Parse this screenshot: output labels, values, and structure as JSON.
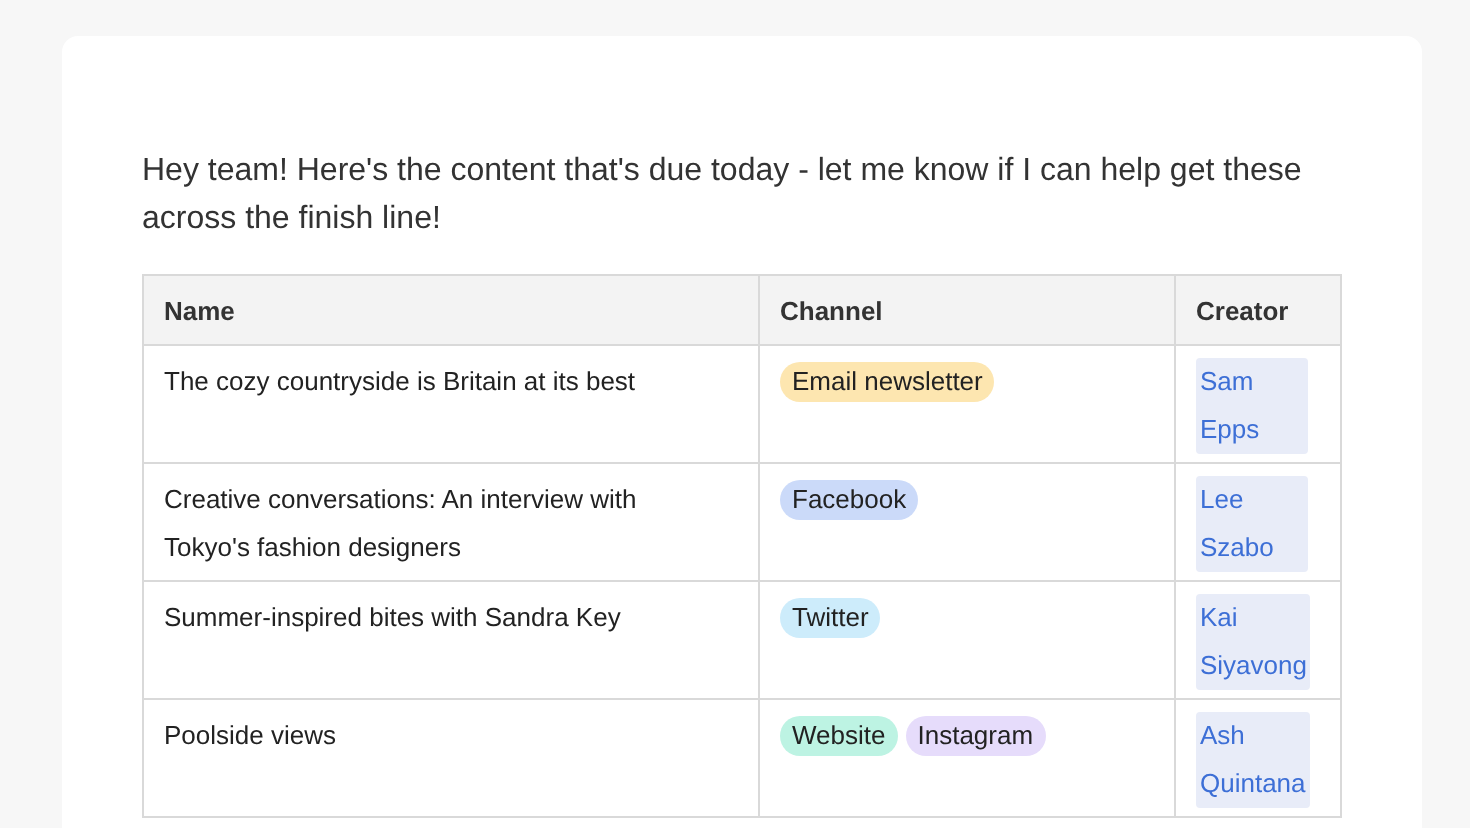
{
  "message": "Hey team! Here's the content that's due today - let me know if I can help get these across the finish line!",
  "table": {
    "columns": [
      "Name",
      "Channel",
      "Creator"
    ],
    "rows": [
      {
        "name": "The cozy countryside is Britain at its best",
        "channels": [
          {
            "label": "Email newsletter",
            "color": "#fde6b0"
          }
        ],
        "creator": "Sam Epps"
      },
      {
        "name": "Creative conversations: An interview with Tokyo's fashion designers",
        "channels": [
          {
            "label": "Facebook",
            "color": "#cbdaf9"
          }
        ],
        "creator": "Lee Szabo"
      },
      {
        "name": "Summer-inspired bites with Sandra Key",
        "channels": [
          {
            "label": "Twitter",
            "color": "#cdecfb"
          }
        ],
        "creator": "Kai Siyavong"
      },
      {
        "name": "Poolside views",
        "channels": [
          {
            "label": "Website",
            "color": "#bdf3e3"
          },
          {
            "label": "Instagram",
            "color": "#e6dcfb"
          }
        ],
        "creator": "Ash Quintana"
      }
    ]
  }
}
